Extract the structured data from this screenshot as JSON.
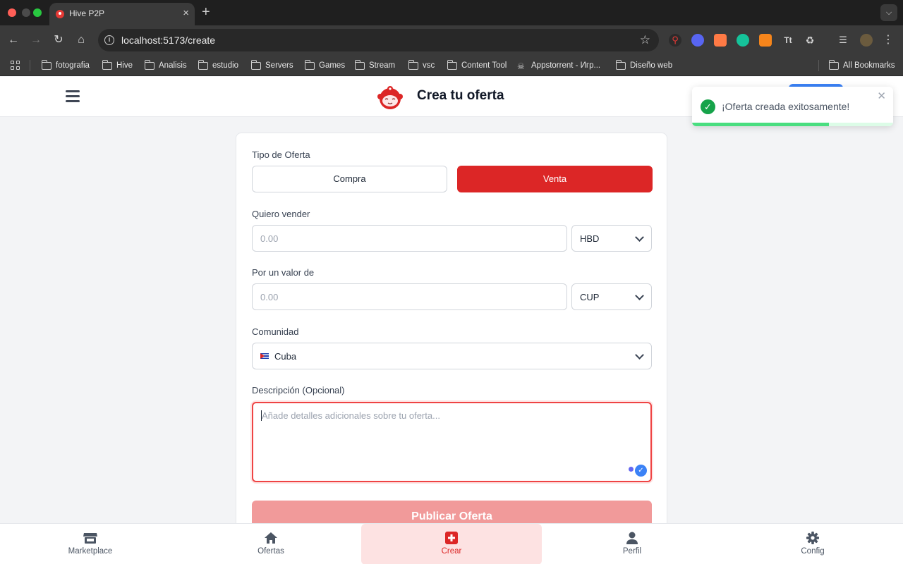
{
  "browser": {
    "tab_title": "Hive P2P",
    "tab_close": "×",
    "new_tab": "+",
    "url": "localhost:5173/create",
    "bookmarks": [
      "fotografia",
      "Hive",
      "Analisis",
      "estudio",
      "Servers",
      "Games",
      "Stream",
      "vsc",
      "Content Tool",
      "Appstorrent - Игр...",
      "Diseño web"
    ],
    "all_bookmarks": "All Bookmarks"
  },
  "header": {
    "title": "Crea tu oferta"
  },
  "toast": {
    "message": "¡Oferta creada exitosamente!",
    "progress": 0.68
  },
  "form": {
    "type_label": "Tipo de Oferta",
    "type_options": [
      "Compra",
      "Venta"
    ],
    "selected_type": "Venta",
    "sell_label": "Quiero vender",
    "sell_placeholder": "0.00",
    "sell_currency": "HBD",
    "value_label": "Por un valor de",
    "value_placeholder": "0.00",
    "value_currency": "CUP",
    "community_label": "Comunidad",
    "community_value": "Cuba",
    "description_label": "Descripción (Opcional)",
    "description_placeholder": "Añade detalles adicionales sobre tu oferta...",
    "submit_label": "Publicar Oferta"
  },
  "bottom_nav": {
    "items": [
      {
        "label": "Marketplace",
        "icon": "store-icon"
      },
      {
        "label": "Ofertas",
        "icon": "home-icon"
      },
      {
        "label": "Crear",
        "icon": "plus-square-icon"
      },
      {
        "label": "Perfil",
        "icon": "user-icon"
      },
      {
        "label": "Config",
        "icon": "gear-icon"
      }
    ],
    "active": "Crear"
  },
  "colors": {
    "accent": "#dc2626",
    "accent_light": "#f19a9a",
    "success": "#16a34a"
  }
}
